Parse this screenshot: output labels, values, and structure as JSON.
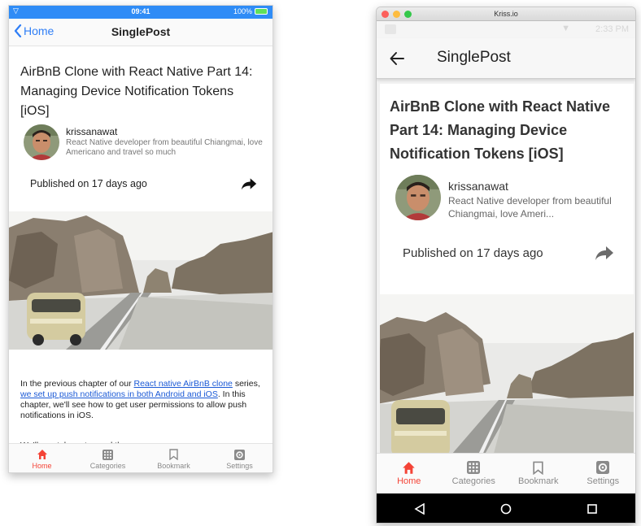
{
  "ios": {
    "status": {
      "time": "09:41",
      "battery": "100%"
    },
    "nav": {
      "back_label": "Home",
      "title": "SinglePost"
    },
    "post": {
      "title": "AirBnB Clone with React Native Part 14: Managing Device Notification Tokens [iOS]",
      "author": "krissanawat",
      "bio": "React Native developer from beautiful Chiangmai, love Americano and travel so much",
      "published": "Published on 17 days ago",
      "para_1": "In the previous chapter of our ",
      "link_1": "React native AirBnB clone",
      "para_2": " series, ",
      "link_2": "we set up push notifications in both Android and iOS",
      "para_3": ". In this chapter, we'll see how to get user permissions to allow push notifications in iOS.",
      "para_next": "We'll use tokens to send them"
    },
    "tabs": [
      {
        "label": "Home",
        "icon": "home-icon"
      },
      {
        "label": "Categories",
        "icon": "grid-icon"
      },
      {
        "label": "Bookmark",
        "icon": "bookmark-icon"
      },
      {
        "label": "Settings",
        "icon": "gear-icon"
      }
    ]
  },
  "android": {
    "window_title": "Kriss.io",
    "status_time": "2:33 PM",
    "appbar_title": "SinglePost",
    "post": {
      "title": "AirBnB Clone with React Native Part 14: Managing Device Notification Tokens [iOS]",
      "author": "krissanawat",
      "bio": "React Native developer from beautiful Chiangmai, love Ameri...",
      "published": "Published on 17 days ago"
    },
    "tabs": [
      {
        "label": "Home",
        "icon": "home-icon"
      },
      {
        "label": "Categories",
        "icon": "grid-icon"
      },
      {
        "label": "Bookmark",
        "icon": "bookmark-icon"
      },
      {
        "label": "Settings",
        "icon": "gear-icon"
      }
    ]
  },
  "colors": {
    "accent": "#f44336",
    "ios_blue": "#2f7ef6",
    "link": "#1a59d6",
    "inactive": "#8a8a8a"
  }
}
